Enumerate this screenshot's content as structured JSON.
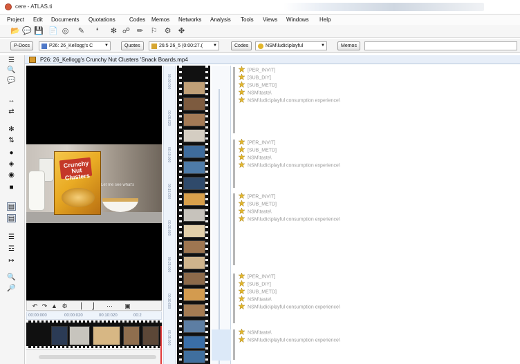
{
  "window": {
    "title": "cere - ATLAS.ti"
  },
  "menu": {
    "items": [
      "Project",
      "Edit",
      "Documents",
      "Quotations",
      "Codes",
      "Memos",
      "Networks",
      "Analysis",
      "Tools",
      "Views",
      "Windows",
      "Help"
    ]
  },
  "toolbar": {
    "icons": [
      "open-folder-icon",
      "comment-icon",
      "save-icon",
      "document-icon",
      "binoculars-icon",
      "edit-document-icon",
      "quotation-icon",
      "code-icon",
      "network-icon",
      "pencil-icon",
      "tag-icon",
      "filter-icon",
      "brush-icon"
    ]
  },
  "manager_bar": {
    "pdocs_button": "P-Docs",
    "pdocs_select": "P26: 26_Kellogg's C",
    "quotes_button": "Quotes",
    "quotes_select": "26:5 26_5 (0:00:27.(",
    "codes_button": "Codes",
    "codes_select": "NSM\\ludic\\playful",
    "memos_button": "Memos"
  },
  "document": {
    "title": "P26: 26_Kellogg's Crunchy Nut Clusters 'Snack Boards.mp4"
  },
  "video": {
    "box_text": "Crunchy Nut Clusters",
    "caption": "Let me see what's"
  },
  "media_controls": {
    "icons": [
      "rewind-icon",
      "play-icon",
      "volume-icon",
      "settings-icon",
      "marker-start-icon",
      "marker-end-icon",
      "more-icon",
      "snapshot-icon"
    ]
  },
  "timeline": {
    "time_labels": [
      "00:00:000",
      "00:00:020",
      "00:10:020",
      "00:2"
    ]
  },
  "time_ruler": {
    "labels": [
      "00:00:000",
      "00:05:020",
      "00:10:000",
      "00:15:000",
      "00:20:000",
      "00:25:000",
      "00:30:000",
      "00:35:000"
    ]
  },
  "margin": {
    "groups": [
      {
        "codes": [
          "[PER_INVIT]",
          "[SUB_DIY]",
          "[SUB_METD]",
          "NSM\\taste\\",
          "NSM\\ludic\\playful consumption experience\\"
        ]
      },
      {
        "codes": [
          "[PER_INVIT]",
          "[SUB_METD]",
          "NSM\\taste\\",
          "NSM\\ludic\\playful consumption experience\\"
        ]
      },
      {
        "codes": [
          "[PER_INVIT]",
          "[SUB_METD]",
          "NSM\\taste\\",
          "NSM\\ludic\\playful consumption experience\\"
        ]
      },
      {
        "codes": [
          "[PER_INVIT]",
          "[SUB_DIY]",
          "[SUB_METD]",
          "NSM\\taste\\",
          "NSM\\ludic\\playful consumption experience\\"
        ]
      },
      {
        "codes": [
          "NSM\\taste\\",
          "NSM\\ludic\\playful consumption experience\\"
        ]
      }
    ]
  },
  "colors": {
    "accent": "#e7eef8",
    "code_icon": "#e2b62c",
    "code_text": "#9a9a9a",
    "marker": "#e23a3a"
  }
}
